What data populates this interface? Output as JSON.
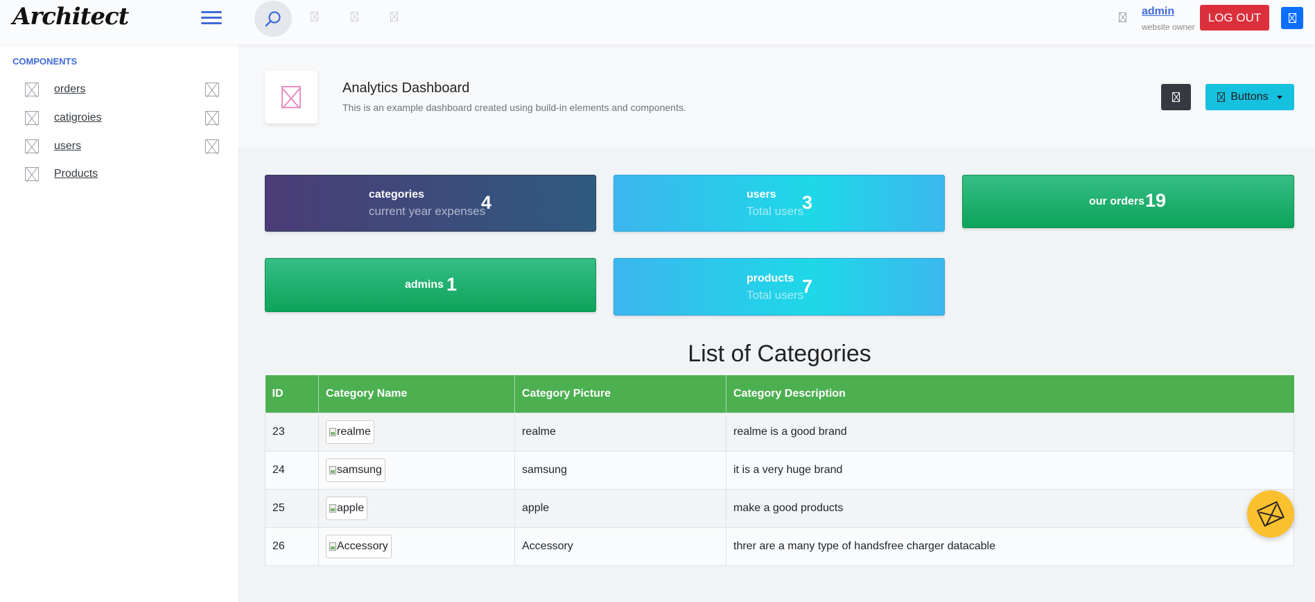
{
  "header": {
    "logo": "Architect",
    "user_name": "admin",
    "user_role": "website owner",
    "logout_label": "LOG OUT"
  },
  "sidebar": {
    "heading": "COMPONENTS",
    "items": [
      {
        "label": "orders"
      },
      {
        "label": "catigroies"
      },
      {
        "label": "users"
      },
      {
        "label": "Products"
      }
    ]
  },
  "page": {
    "title": "Analytics Dashboard",
    "subtitle": "This is an example dashboard created using build-in elements and components.",
    "buttons_label": "Buttons"
  },
  "cards": {
    "categories": {
      "title": "categories",
      "sub": "current year expenses",
      "value": "4"
    },
    "users": {
      "title": "users",
      "sub": "Total users",
      "value": "3"
    },
    "orders": {
      "title": "our orders",
      "value": "19"
    },
    "admins": {
      "title": "admins",
      "value": "1"
    },
    "products": {
      "title": "products",
      "sub": "Total users",
      "value": "7"
    }
  },
  "table": {
    "title": "List of Categories",
    "headers": [
      "ID",
      "Category Name",
      "Category Picture",
      "Category Description"
    ],
    "rows": [
      {
        "id": "23",
        "name_alt": "realme",
        "picture": "realme",
        "description": "realme is a good brand"
      },
      {
        "id": "24",
        "name_alt": "samsung",
        "picture": "samsung",
        "description": "it is a very huge brand"
      },
      {
        "id": "25",
        "name_alt": "apple",
        "picture": "apple",
        "description": "make a good products"
      },
      {
        "id": "26",
        "name_alt": "Accessory",
        "picture": "Accessory",
        "description": "threr are a many type of handsfree charger datacable"
      }
    ]
  },
  "colors": {
    "accent": "#3f6ad8",
    "logout": "#dc2f3c",
    "table_header": "#4caf50",
    "fab": "#fbc02d"
  }
}
